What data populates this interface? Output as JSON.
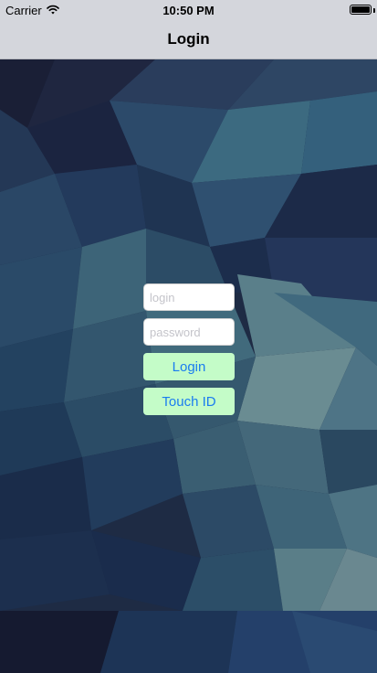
{
  "status_bar": {
    "carrier": "Carrier",
    "time": "10:50 PM",
    "wifi_icon": "wifi-icon",
    "battery_icon": "battery-icon",
    "battery_level": 1.0
  },
  "nav": {
    "title": "Login"
  },
  "form": {
    "login_placeholder": "login",
    "login_value": "",
    "password_placeholder": "password",
    "password_value": "",
    "login_button_label": "Login",
    "touch_id_button_label": "Touch ID"
  },
  "colors": {
    "button_background": "#c4fcc8",
    "button_text": "#1a7cf0",
    "nav_background": "#d4d6dc",
    "background_base": "#1b2842"
  }
}
